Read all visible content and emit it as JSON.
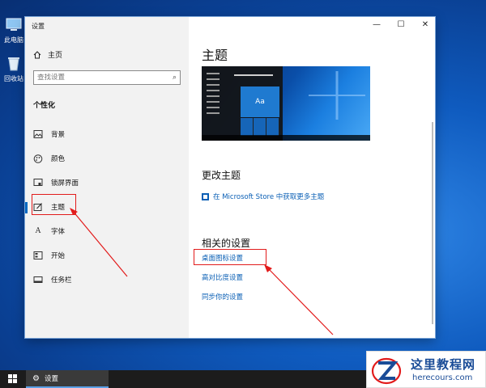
{
  "desktop": {
    "icons": [
      {
        "label": "此电脑"
      },
      {
        "label": "回收站"
      }
    ]
  },
  "window": {
    "title": "设置",
    "controls": {
      "minimize": "—",
      "maximize": "☐",
      "close": "✕"
    }
  },
  "sidebar": {
    "home_label": "主页",
    "search": {
      "placeholder": "查找设置"
    },
    "section_title": "个性化",
    "items": [
      {
        "label": "背景",
        "icon": "picture-icon"
      },
      {
        "label": "颜色",
        "icon": "palette-icon"
      },
      {
        "label": "锁屏界面",
        "icon": "lock-screen-icon"
      },
      {
        "label": "主题",
        "icon": "theme-brush-icon",
        "active": true
      },
      {
        "label": "字体",
        "icon": "font-icon"
      },
      {
        "label": "开始",
        "icon": "start-icon"
      },
      {
        "label": "任务栏",
        "icon": "taskbar-icon"
      }
    ]
  },
  "content": {
    "title": "主题",
    "preview_tile_text": "Aa",
    "change_theme_heading": "更改主题",
    "store_link": "在 Microsoft Store 中获取更多主题",
    "related_heading": "相关的设置",
    "links": [
      "桌面图标设置",
      "高对比度设置",
      "同步你的设置"
    ]
  },
  "taskbar": {
    "app_label": "设置"
  },
  "watermark": {
    "title": "这里教程网",
    "domain": "herecours.com"
  },
  "colors": {
    "accent": "#0067c0",
    "link": "#0a5fb5",
    "annotation": "#e21b1b"
  }
}
